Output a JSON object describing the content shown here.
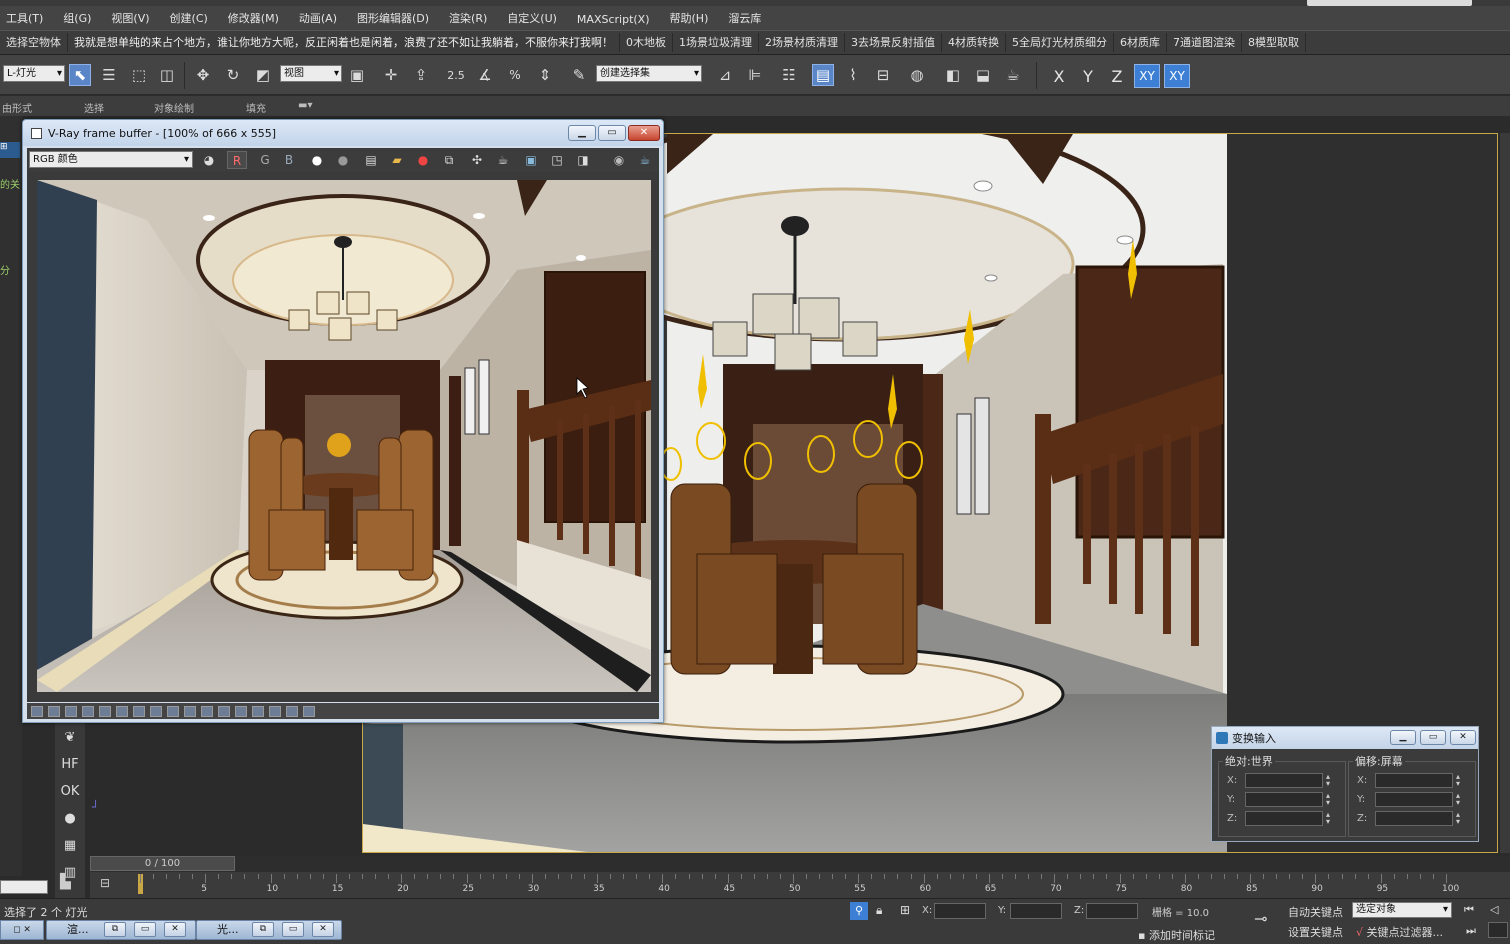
{
  "menu": [
    "工具(T)",
    "组(G)",
    "视图(V)",
    "创建(C)",
    "修改器(M)",
    "动画(A)",
    "图形编辑器(D)",
    "渲染(R)",
    "自定义(U)",
    "MAXScript(X)",
    "帮助(H)",
    "溜云库"
  ],
  "script_buttons": [
    "选择空物体",
    "我就是想单纯的来占个地方，谁让你地方大呢，反正闲着也是闲着，浪费了还不如让我躺着，不服你来打我啊！",
    "0木地板",
    "1场景垃圾清理",
    "2场景材质清理",
    "3去场景反射插值",
    "4材质转换",
    "5全局灯光材质细分",
    "6材质库",
    "7通道图渲染",
    "8模型取取"
  ],
  "toolbar": {
    "filter_select": "L-灯光",
    "ref_coord_select": "视图",
    "named_selection": "创建选择集",
    "axis_x": "X",
    "axis_y": "Y",
    "axis_z": "Z",
    "axis_xy": "XY",
    "axis_xy2": "XY"
  },
  "ribbon": [
    "由形式",
    "选择",
    "对象绘制",
    "填充"
  ],
  "vfb": {
    "title": "V-Ray frame buffer - [100% of 666 x 555]",
    "channel": "RGB 颜色",
    "ch_r": "R",
    "ch_g": "G",
    "ch_b": "B"
  },
  "left_hints": [
    "的关",
    "分"
  ],
  "xform": {
    "title": "变换输入",
    "left_group": "绝对:世界",
    "right_group": "偏移:屏幕",
    "x": "X:",
    "y": "Y:",
    "z": "Z:"
  },
  "timeline": {
    "slider": "0 / 100",
    "ticks": [
      "5",
      "10",
      "15",
      "20",
      "25",
      "30",
      "35",
      "40",
      "45",
      "50",
      "55",
      "60",
      "65",
      "70",
      "75",
      "80",
      "85",
      "90",
      "95",
      "100"
    ]
  },
  "status": {
    "selection": "选择了 2 个 灯光",
    "grid": "栅格 = 10.0",
    "auto_key": "自动关键点",
    "set_key": "设置关键点",
    "key_target": "选定对象",
    "key_filter": "关键点过滤器...",
    "add_time_tag": "添加时间标记",
    "x_label": "X:",
    "y_label": "Y:",
    "z_label": "Z:"
  },
  "taskbar": [
    "渲...",
    "光..."
  ]
}
